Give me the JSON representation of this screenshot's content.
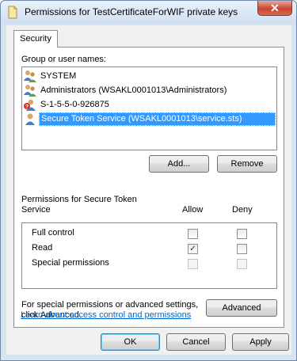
{
  "window": {
    "title": "Permissions for TestCertificateForWIF private keys",
    "close_symbol": "✕"
  },
  "tabs": [
    {
      "label": "Security",
      "active": true
    }
  ],
  "group_section": {
    "label": "Group or user names:",
    "items": [
      {
        "label": "SYSTEM",
        "icon": "user-group-icon",
        "selected": false
      },
      {
        "label": "Administrators (WSAKL0001013\\Administrators)",
        "icon": "user-group-icon",
        "selected": false
      },
      {
        "label": "S-1-5-5-0-926875",
        "icon": "unknown-user-icon",
        "selected": false
      },
      {
        "label": "Secure Token Service (WSAKL0001013\\service.sts)",
        "icon": "user-icon",
        "selected": true
      }
    ]
  },
  "buttons": {
    "add": "Add...",
    "remove": "Remove",
    "advanced": "Advanced",
    "ok": "OK",
    "cancel": "Cancel",
    "apply": "Apply"
  },
  "permissions": {
    "title_line1": "Permissions for Secure Token",
    "title_line2": "Service",
    "allow_header": "Allow",
    "deny_header": "Deny",
    "rows": [
      {
        "name": "Full control",
        "allow": false,
        "deny": false,
        "enabled": true
      },
      {
        "name": "Read",
        "allow": true,
        "deny": false,
        "enabled": true
      },
      {
        "name": "Special permissions",
        "allow": false,
        "deny": false,
        "enabled": false
      }
    ]
  },
  "advanced_text": {
    "line1": "For special permissions or advanced settings,",
    "line2": "click Advanced."
  },
  "learn_link": "Learn about access control and permissions"
}
